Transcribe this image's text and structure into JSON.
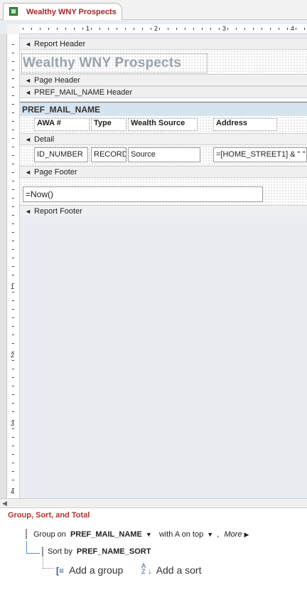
{
  "tab": {
    "title": "Wealthy WNY Prospects",
    "icon": "report-icon"
  },
  "ruler": {
    "h_numbers": [
      "1",
      "2",
      "3",
      "4"
    ],
    "v_numbers": [
      "1",
      "2",
      "3",
      "4"
    ]
  },
  "sections": {
    "report_header": "Report Header",
    "page_header": "Page Header",
    "group_header": "PREF_MAIL_NAME Header",
    "detail": "Detail",
    "page_footer": "Page Footer",
    "report_footer": "Report Footer"
  },
  "report_title": "Wealthy WNY Prospects",
  "group_band_label": "PREF_MAIL_NAME",
  "column_labels": [
    "AWA #",
    "Type",
    "Wealth Source",
    "Address"
  ],
  "detail_fields": [
    "ID_NUMBER",
    "RECORD_",
    "Source",
    "=[HOME_STREET1] & \" \""
  ],
  "footer_field": "=Now()",
  "gst": {
    "title": "Group, Sort, and Total",
    "group_on_prefix": "Group on",
    "group_on_field": "PREF_MAIL_NAME",
    "order": "with A on top",
    "more": "More",
    "sort_by_prefix": "Sort by",
    "sort_by_field": "PREF_NAME_SORT",
    "add_group": "Add a group",
    "add_sort": "Add a sort"
  }
}
